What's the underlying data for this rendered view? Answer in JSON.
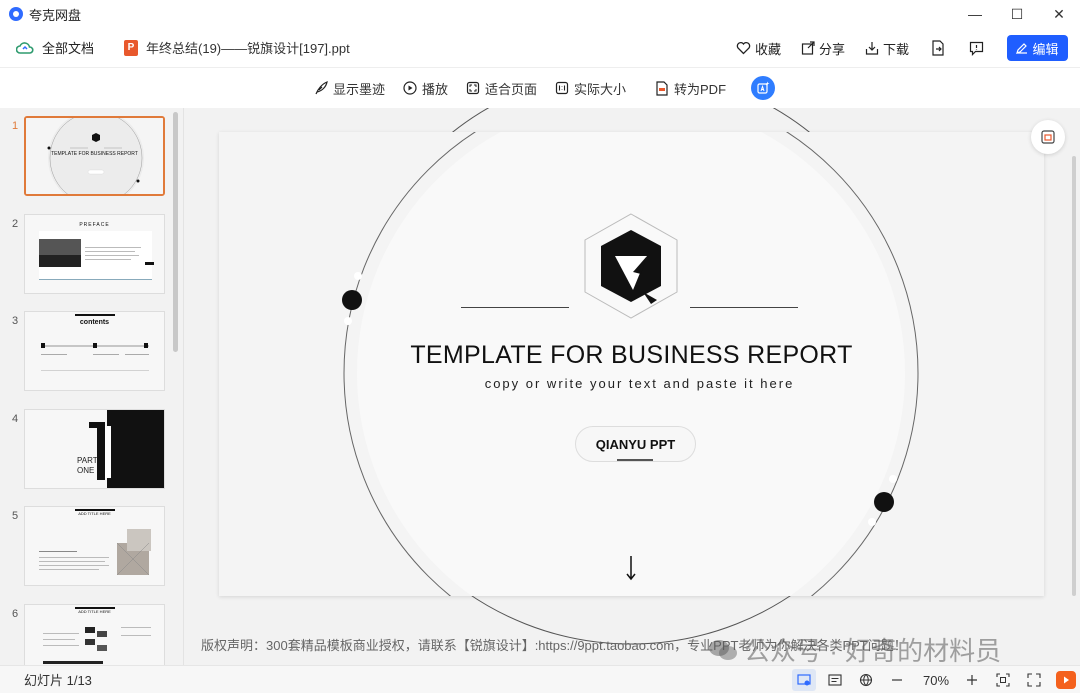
{
  "app": {
    "name": "夸克网盘"
  },
  "window_controls": {
    "minimize": "—",
    "maximize": "☐",
    "close": "✕"
  },
  "docbar": {
    "all_docs": "全部文档",
    "file_badge": "P",
    "file_title": "年终总结(19)——锐旗设计[197].ppt",
    "favorite": "收藏",
    "share": "分享",
    "download": "下载",
    "edit": "编辑"
  },
  "toolbar": {
    "show_ink": "显示墨迹",
    "play": "播放",
    "fit_page": "适合页面",
    "actual_size": "实际大小",
    "to_pdf": "转为PDF"
  },
  "thumbnails": [
    {
      "num": "1",
      "text": "TEMPLATE FOR BUSINESS REPORT"
    },
    {
      "num": "2",
      "text": "PREFACE"
    },
    {
      "num": "3",
      "text": "contents"
    },
    {
      "num": "4",
      "text": "PART ONE"
    },
    {
      "num": "5",
      "text": "ADD TITLE HERE"
    },
    {
      "num": "6",
      "text": "ADD TITLE HERE"
    }
  ],
  "slide": {
    "title": "TEMPLATE FOR BUSINESS REPORT",
    "subtitle": "copy or write your text and paste it here",
    "pill": "QIANYU PPT"
  },
  "copyright": "版权声明：300套精品模板商业授权，请联系【锐旗设计】:https://9ppt.taobao.com，专业PPT老师为你解决各类PPT问题！",
  "watermark": "公众号 · 好奇的材料员",
  "status": {
    "slide_count": "幻灯片 1/13",
    "zoom": "70%"
  }
}
